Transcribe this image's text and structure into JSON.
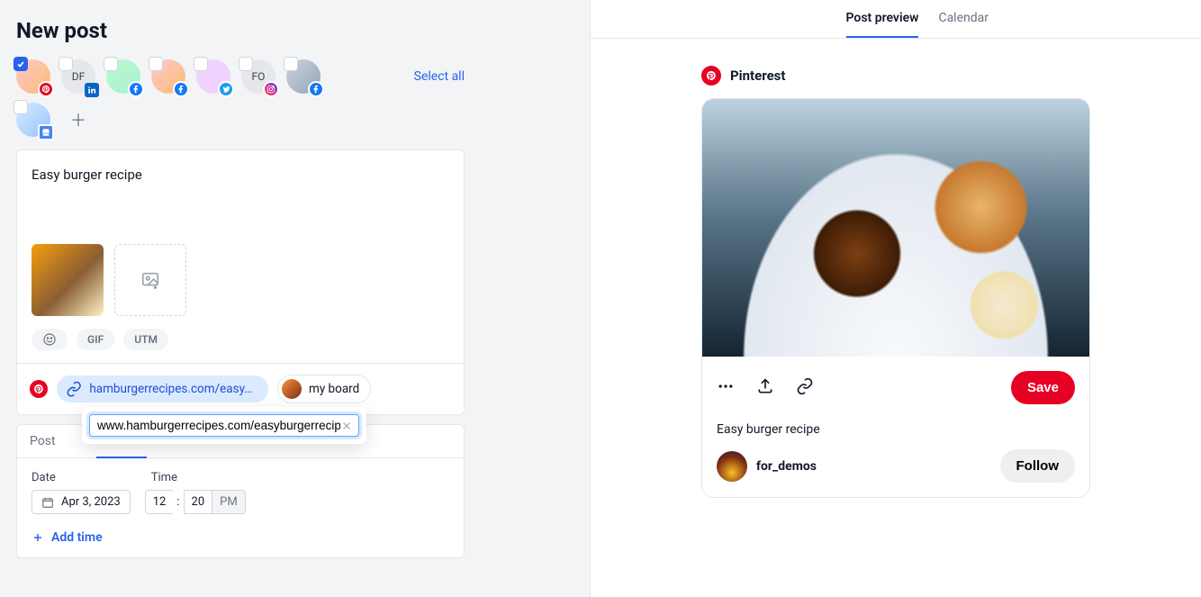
{
  "header": {
    "title": "New post",
    "select_all": "Select all"
  },
  "profiles": [
    {
      "id": "p1",
      "selected": true,
      "initials": "",
      "net": "pinterest"
    },
    {
      "id": "p2",
      "selected": false,
      "initials": "DF",
      "net": "linkedin"
    },
    {
      "id": "p3",
      "selected": false,
      "initials": "",
      "net": "facebook"
    },
    {
      "id": "p4",
      "selected": false,
      "initials": "",
      "net": "facebook"
    },
    {
      "id": "p5",
      "selected": false,
      "initials": "",
      "net": "twitter"
    },
    {
      "id": "p6",
      "selected": false,
      "initials": "FO",
      "net": "instagram"
    },
    {
      "id": "p7",
      "selected": false,
      "initials": "",
      "net": "facebook"
    },
    {
      "id": "p8",
      "selected": false,
      "initials": "",
      "net": "gmb"
    }
  ],
  "editor": {
    "text": "Easy burger recipe",
    "chips": {
      "gif": "GIF",
      "utm": "UTM"
    },
    "link_pill": "hamburgerrecipes.com/easy…",
    "board_pill": "my board",
    "url_input": "www.hamburgerrecipes.com/easyburgerrecipe"
  },
  "schedule": {
    "tab_post": "Post",
    "label_date": "Date",
    "label_time": "Time",
    "date": "Apr 3, 2023",
    "hour": "12",
    "minute": "20",
    "ampm": "PM",
    "add_time": "Add time"
  },
  "preview": {
    "tab_preview": "Post preview",
    "tab_calendar": "Calendar",
    "platform": "Pinterest",
    "save": "Save",
    "caption": "Easy burger recipe",
    "author": "for_demos",
    "follow": "Follow"
  }
}
